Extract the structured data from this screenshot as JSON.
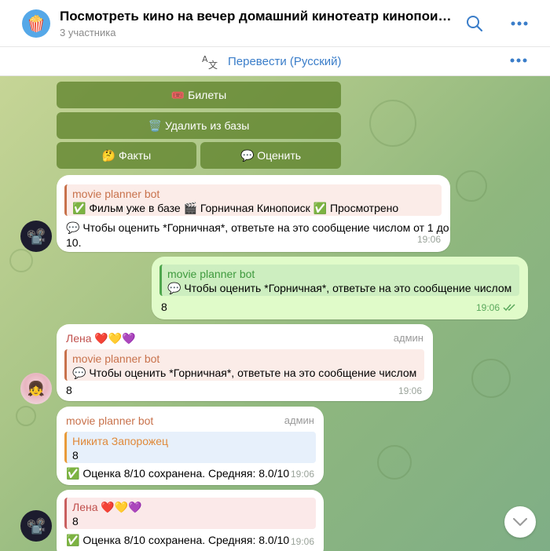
{
  "header": {
    "title": "Посмотреть кино на вечер домашний кинотеатр кинопоиск отл...",
    "subtitle": "3 участника",
    "chat_avatar_emoji": "🍿"
  },
  "translate_bar": {
    "label": "Перевести (Русский)"
  },
  "keyboard": {
    "tickets": "🎟️ Билеты",
    "delete": "🗑️ Удалить из базы",
    "facts": "🤔 Факты",
    "rate": "💬 Оценить"
  },
  "messages": [
    {
      "reply_name": "movie planner bot",
      "reply_text": "✅ Фильм уже в базе  🎬 Горничная  Кинопоиск  ✅ Просмотрено",
      "text": "💬 Чтобы оценить *Горничная*, ответьте на это сообщение числом от 1 до 10.",
      "time": "19:06"
    },
    {
      "reply_name": "movie planner bot",
      "reply_text": "💬 Чтобы оценить *Горничная*, ответьте на это сообщение числом",
      "text": "8",
      "time": "19:06"
    },
    {
      "sender": "Лена ❤️💛💜",
      "role": "админ",
      "reply_name": "movie planner bot",
      "reply_text": "💬 Чтобы оценить *Горничная*, ответьте на это сообщение числом",
      "text": "8",
      "time": "19:06"
    },
    {
      "sender": "movie planner bot",
      "role": "админ",
      "reply_name": "Никита Запорожец",
      "reply_text": "8",
      "text": "✅ Оценка 8/10 сохранена. Средняя: 8.0/10",
      "time": "19:06"
    },
    {
      "reply_name": "Лена ❤️💛💜",
      "reply_text": "8",
      "text": "✅ Оценка 8/10 сохранена. Средняя: 8.0/10",
      "time": "19:06"
    }
  ],
  "colors": {
    "accent": "#3a7dc9",
    "orange_name": "#c8724c",
    "green_name": "#3f9a3e",
    "red_name": "#c0504d",
    "nikita_name": "#e0893a"
  }
}
